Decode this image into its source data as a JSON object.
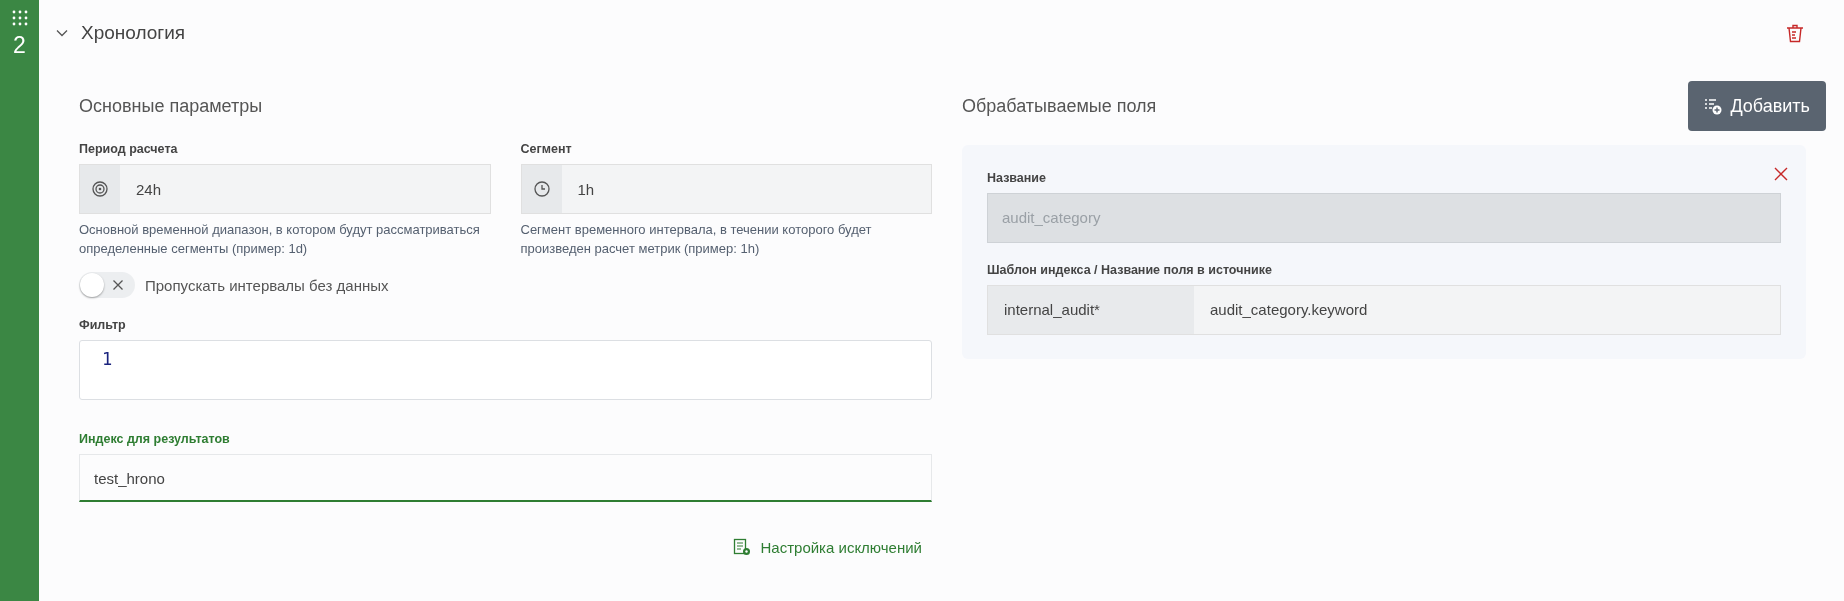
{
  "step": {
    "number": "2"
  },
  "section": {
    "title": "Хронология",
    "expanded": true
  },
  "main_params": {
    "title": "Основные параметры",
    "fields": [
      {
        "label": "Период расчета",
        "kind": "target",
        "value": "24h",
        "help": "Основной временной диапазон, в котором будут рассматриваться определенные сегменты (пример: 1d)"
      },
      {
        "label": "Сегмент",
        "kind": "clock",
        "value": "1h",
        "help": "Сегмент временного интервала, в течении которого будет произведен расчет метрик (пример: 1h)"
      }
    ],
    "toggle": {
      "label": "Пропускать интервалы без данных",
      "on": false
    },
    "filter": {
      "label": "Фильтр",
      "line_number": "1"
    },
    "result_index": {
      "label": "Индекс для результатов",
      "value": "test_hrono",
      "focused": true
    },
    "exclusions_link": "Настройка исключений"
  },
  "processed_fields": {
    "title": "Обрабатываемые поля",
    "add_button": "Добавить",
    "items": [
      {
        "name_label": "Название",
        "name": "audit_category",
        "disabled": true,
        "template_label": "Шаблон индекса / Название поля в источнике",
        "index_pattern": "internal_audit*",
        "source_field": "audit_category.keyword"
      }
    ]
  }
}
